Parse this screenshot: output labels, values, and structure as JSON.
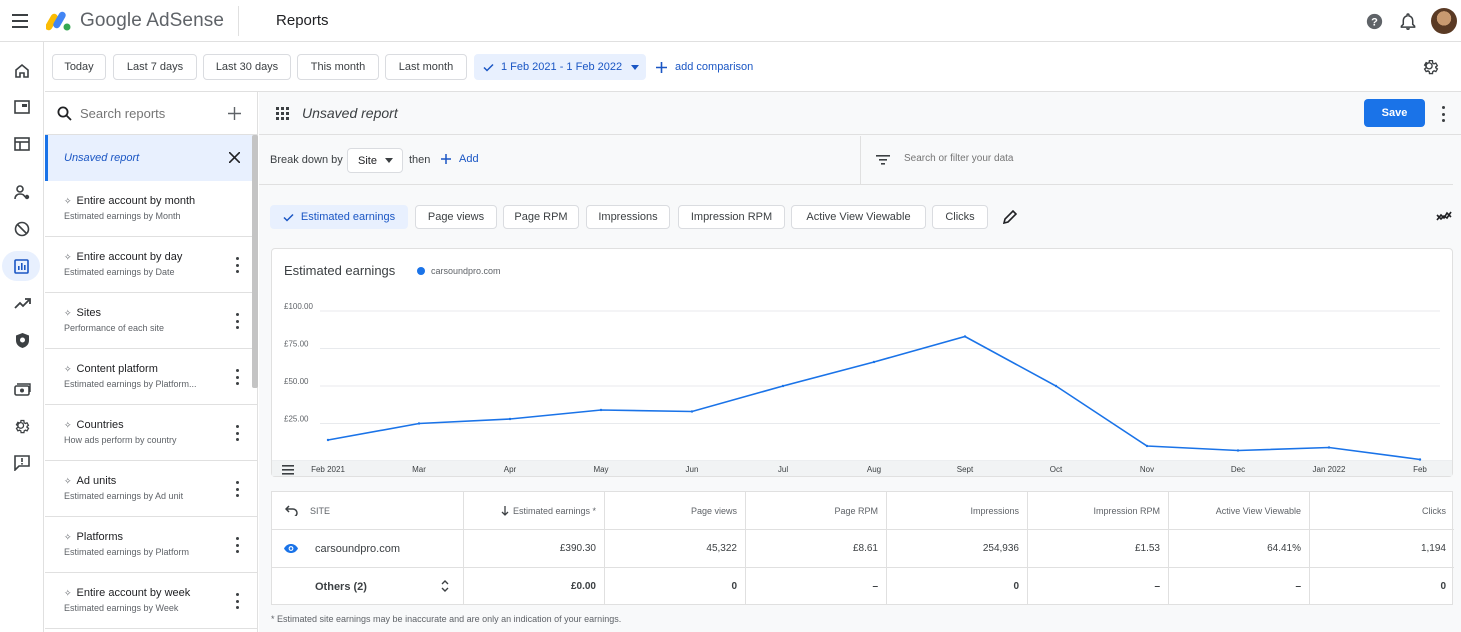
{
  "app": {
    "brand": "Google AdSense",
    "page_title": "Reports"
  },
  "date_ranges": {
    "chips": [
      "Today",
      "Last 7 days",
      "Last 30 days",
      "This month",
      "Last month"
    ],
    "selected_range": "1 Feb 2021 - 1 Feb 2022",
    "add_comparison": "add comparison"
  },
  "sidebar": {
    "search_placeholder": "Search reports",
    "unsaved_label": "Unsaved report",
    "items": [
      {
        "title": "Entire account by month",
        "subtitle": "Estimated earnings by Month"
      },
      {
        "title": "Entire account by day",
        "subtitle": "Estimated earnings by Date"
      },
      {
        "title": "Sites",
        "subtitle": "Performance of each site"
      },
      {
        "title": "Content platform",
        "subtitle": "Estimated earnings by Platform..."
      },
      {
        "title": "Countries",
        "subtitle": "How ads perform by country"
      },
      {
        "title": "Ad units",
        "subtitle": "Estimated earnings by Ad unit"
      },
      {
        "title": "Platforms",
        "subtitle": "Estimated earnings by Platform"
      },
      {
        "title": "Entire account by week",
        "subtitle": "Estimated earnings by Week"
      }
    ]
  },
  "report": {
    "title": "Unsaved report",
    "save_label": "Save",
    "breakdown_label": "Break down by",
    "breakdown_value": "Site",
    "then_label": "then",
    "add_label": "Add",
    "filter_placeholder": "Search or filter your data"
  },
  "metrics": {
    "chips": [
      "Estimated earnings",
      "Page views",
      "Page RPM",
      "Impressions",
      "Impression RPM",
      "Active View Viewable",
      "Clicks"
    ],
    "selected": "Estimated earnings"
  },
  "chart_data": {
    "type": "line",
    "title": "Estimated earnings",
    "series": [
      {
        "name": "carsoundpro.com",
        "color": "#1a73e8",
        "values": [
          14,
          25,
          28,
          34,
          33,
          50,
          66,
          83,
          50,
          10,
          7,
          9,
          1
        ]
      }
    ],
    "x": [
      "Feb 2021",
      "Mar",
      "Apr",
      "May",
      "Jun",
      "Jul",
      "Aug",
      "Sept",
      "Oct",
      "Nov",
      "Dec",
      "Jan 2022",
      "Feb"
    ],
    "y_ticks": [
      "£25.00",
      "£50.00",
      "£75.00",
      "£100.00"
    ],
    "y_tick_values": [
      25,
      50,
      75,
      100
    ],
    "ylim": [
      0,
      100
    ],
    "grid": true
  },
  "table": {
    "headers": [
      "SITE",
      "Estimated earnings *",
      "Page views",
      "Page RPM",
      "Impressions",
      "Impression RPM",
      "Active View Viewable",
      "Clicks"
    ],
    "rows": [
      {
        "site": "carsoundpro.com",
        "values": [
          "£390.30",
          "45,322",
          "£8.61",
          "254,936",
          "£1.53",
          "64.41%",
          "1,194"
        ]
      },
      {
        "site": "Others (2)",
        "values": [
          "£0.00",
          "0",
          "–",
          "0",
          "–",
          "–",
          "0"
        ]
      }
    ]
  },
  "footnote": "* Estimated site earnings may be inaccurate and are only an indication of your earnings."
}
